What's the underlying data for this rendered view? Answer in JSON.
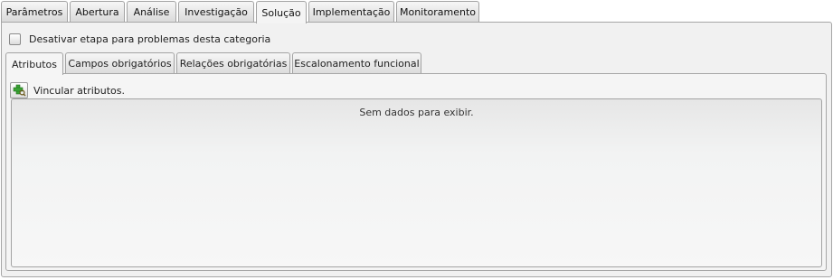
{
  "main_tabs": [
    {
      "label": "Parâmetros"
    },
    {
      "label": "Abertura"
    },
    {
      "label": "Análise"
    },
    {
      "label": "Investigação"
    },
    {
      "label": "Solução",
      "active": true
    },
    {
      "label": "Implementação"
    },
    {
      "label": "Monitoramento"
    }
  ],
  "disable_step": {
    "label": "Desativar etapa para problemas desta categoria",
    "checked": false
  },
  "sub_tabs": [
    {
      "label": "Atributos",
      "active": true
    },
    {
      "label": "Campos obrigatórios"
    },
    {
      "label": "Relações obrigatórias"
    },
    {
      "label": "Escalonamento funcional"
    }
  ],
  "toolbar": {
    "link_label": "Vincular atributos.",
    "link_icon": "add-link-icon"
  },
  "grid": {
    "empty_message": "Sem dados para exibir."
  }
}
